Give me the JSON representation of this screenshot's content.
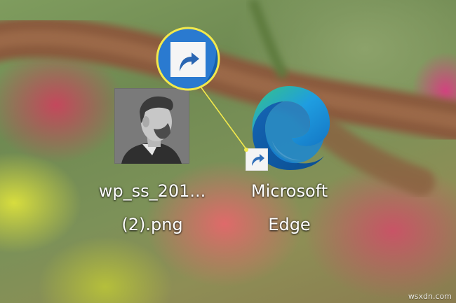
{
  "desktop": {
    "icons": [
      {
        "label_line1": "wp_ss_201...",
        "label_line2": "(2).png",
        "type": "image-thumbnail"
      },
      {
        "label_line1": "Microsoft",
        "label_line2": "Edge",
        "type": "application-shortcut",
        "icon": "edge-icon",
        "overlay": "shortcut-arrow-icon"
      }
    ],
    "magnifier": {
      "content": "shortcut-arrow-icon",
      "ring_color": "#f2e94c"
    }
  },
  "watermark": "wsxdn.com",
  "colors": {
    "edge_blue_dark": "#0c59a4",
    "edge_blue": "#1a8ad4",
    "edge_green": "#33c481",
    "highlight_yellow": "#f2e94c"
  }
}
